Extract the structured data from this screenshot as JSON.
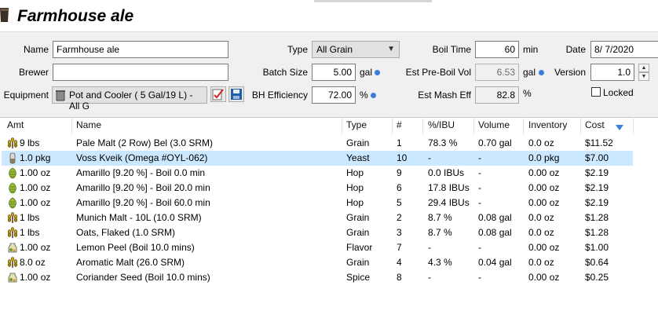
{
  "recipe": {
    "title": "Farmhouse ale",
    "name_label": "Name",
    "name_value": "Farmhouse ale",
    "brewer_label": "Brewer",
    "brewer_value": "",
    "equipment_label": "Equipment",
    "equipment_value": "Pot and Cooler ( 5 Gal/19 L) - All G",
    "type_label": "Type",
    "type_value": "All Grain",
    "batch_size_label": "Batch Size",
    "batch_size_value": "5.00",
    "batch_size_unit": "gal",
    "bh_eff_label": "BH Efficiency",
    "bh_eff_value": "72.00",
    "bh_eff_unit": "%",
    "boil_time_label": "Boil Time",
    "boil_time_value": "60",
    "boil_time_unit": "min",
    "pre_boil_label": "Est Pre-Boil Vol",
    "pre_boil_value": "6.53",
    "pre_boil_unit": "gal",
    "mash_eff_label": "Est Mash Eff",
    "mash_eff_value": "82.8",
    "mash_eff_unit": "%",
    "date_label": "Date",
    "date_value": "8/ 7/2020",
    "version_label": "Version",
    "version_value": "1.0",
    "locked_label": "Locked"
  },
  "colors": {
    "accent_dot": "#3b7ddd",
    "selection": "#cce8ff"
  },
  "ingredients": {
    "headers": [
      "Amt",
      "Name",
      "Type",
      "#",
      "%/IBU",
      "Volume",
      "Inventory",
      "Cost"
    ],
    "sort_icon": "filter-triangle-icon",
    "rows": [
      {
        "icon": "grain-icon",
        "amt": "9 lbs",
        "name": "Pale Malt (2 Row) Bel (3.0 SRM)",
        "type": "Grain",
        "num": "1",
        "pct": "78.3 %",
        "vol": "0.70 gal",
        "inv": "0.0 oz",
        "cost": "$11.52"
      },
      {
        "icon": "yeast-icon",
        "amt": "1.0 pkg",
        "name": "Voss Kveik (Omega #OYL-062)",
        "type": "Yeast",
        "num": "10",
        "pct": "-",
        "vol": "-",
        "inv": "0.0 pkg",
        "cost": "$7.00"
      },
      {
        "icon": "hop-icon",
        "amt": "1.00 oz",
        "name": "Amarillo [9.20 %] - Boil 0.0 min",
        "type": "Hop",
        "num": "9",
        "pct": "0.0 IBUs",
        "vol": "-",
        "inv": "0.00 oz",
        "cost": "$2.19"
      },
      {
        "icon": "hop-icon",
        "amt": "1.00 oz",
        "name": "Amarillo [9.20 %] - Boil 20.0 min",
        "type": "Hop",
        "num": "6",
        "pct": "17.8 IBUs",
        "vol": "-",
        "inv": "0.00 oz",
        "cost": "$2.19"
      },
      {
        "icon": "hop-icon",
        "amt": "1.00 oz",
        "name": "Amarillo [9.20 %] - Boil 60.0 min",
        "type": "Hop",
        "num": "5",
        "pct": "29.4 IBUs",
        "vol": "-",
        "inv": "0.00 oz",
        "cost": "$2.19"
      },
      {
        "icon": "grain-icon",
        "amt": "1 lbs",
        "name": "Munich Malt - 10L (10.0 SRM)",
        "type": "Grain",
        "num": "2",
        "pct": "8.7 %",
        "vol": "0.08 gal",
        "inv": "0.0 oz",
        "cost": "$1.28"
      },
      {
        "icon": "grain-icon",
        "amt": "1 lbs",
        "name": "Oats, Flaked (1.0 SRM)",
        "type": "Grain",
        "num": "3",
        "pct": "8.7 %",
        "vol": "0.08 gal",
        "inv": "0.0 oz",
        "cost": "$1.28"
      },
      {
        "icon": "misc-icon",
        "amt": "1.00 oz",
        "name": "Lemon Peel (Boil 10.0 mins)",
        "type": "Flavor",
        "num": "7",
        "pct": "-",
        "vol": "-",
        "inv": "0.00 oz",
        "cost": "$1.00"
      },
      {
        "icon": "grain-icon",
        "amt": "8.0 oz",
        "name": "Aromatic Malt (26.0 SRM)",
        "type": "Grain",
        "num": "4",
        "pct": "4.3 %",
        "vol": "0.04 gal",
        "inv": "0.0 oz",
        "cost": "$0.64"
      },
      {
        "icon": "misc-icon",
        "amt": "1.00 oz",
        "name": "Coriander Seed (Boil 10.0 mins)",
        "type": "Spice",
        "num": "8",
        "pct": "-",
        "vol": "-",
        "inv": "0.00 oz",
        "cost": "$0.25"
      }
    ]
  }
}
